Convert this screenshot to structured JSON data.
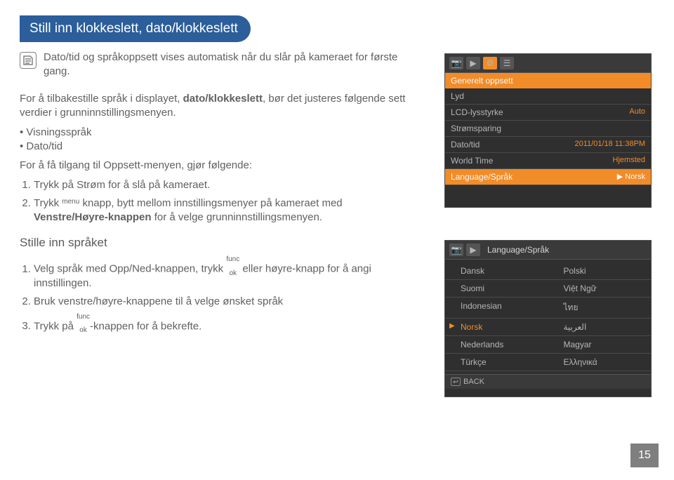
{
  "title": "Still inn klokkeslett, dato/klokkeslett",
  "note": "Dato/tid og språkoppsett vises automatisk når du slår på kameraet for første gang.",
  "para1_a": "For å tilbakestille språk i displayet, ",
  "para1_bold": "dato/klokkeslett",
  "para1_b": ", bør det justeres følgende sett verdier i grunninnstillingsmenyen.",
  "bullets": [
    "Visningsspråk",
    "Dato/tid"
  ],
  "instr_lead": "For å få tilgang til Oppsett-menyen, gjør følgende:",
  "steps_a": [
    "Trykk på Strøm for å slå på kameraet.",
    "Trykk menu knapp, bytt mellom innstillingsmenyer på kameraet med Venstre/Høyre-knappen for å velge grunninnstillingsmenyen."
  ],
  "step2_pre": "Trykk ",
  "step2_menu": "menu",
  "step2_post": " knapp, bytt mellom innstillingsmenyer på kameraet med ",
  "step2_bold": "Venstre/Høyre-knappen",
  "step2_end": " for å velge grunninnstillingsmenyen.",
  "subheading": "Stille inn språket",
  "sb1_pre": "Velg språk med Opp/Ned-knappen, trykk ",
  "funcok": {
    "top": "func",
    "bottom": "ok"
  },
  "sb1_mid": " eller høyre-knapp for å angi innstillingen.",
  "sb2": "Bruk venstre/høyre-knappene til å velge ønsket språk",
  "sb3_pre": "Trykk på ",
  "sb3_post": "-knappen for å bekrefte.",
  "screen1": {
    "title": "Generelt oppsett",
    "rows": [
      {
        "label": "Lyd",
        "val": ""
      },
      {
        "label": "LCD-lysstyrke",
        "val": "Auto"
      },
      {
        "label": "Strømsparing",
        "val": ""
      },
      {
        "label": "Dato/tid",
        "val": "2011/01/18 11:38PM"
      },
      {
        "label": "World Time",
        "val": "Hjemsted"
      },
      {
        "label": "Language/Språk",
        "val": "▶ Norsk",
        "selected": true
      }
    ]
  },
  "screen2": {
    "title": "Language/Språk",
    "rows": [
      {
        "l": "Dansk",
        "r": "Polski"
      },
      {
        "l": "Suomi",
        "r": "Việt Ngữ"
      },
      {
        "l": "Indonesian",
        "r": "ไทย"
      },
      {
        "l": "Norsk",
        "l_sel": true,
        "r": "العربية"
      },
      {
        "l": "Nederlands",
        "r": "Magyar"
      },
      {
        "l": "Türkçe",
        "r": "Ελληνικά"
      }
    ],
    "back": "BACK"
  },
  "page": "15"
}
